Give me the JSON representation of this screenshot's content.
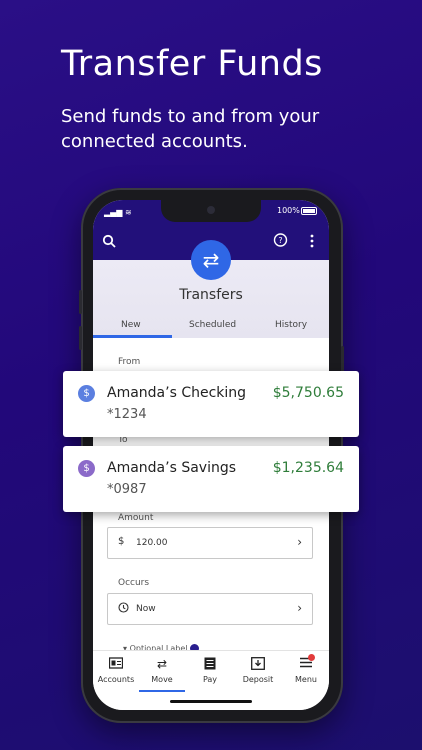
{
  "promo": {
    "headline": "Transfer Funds",
    "subline": "Send funds to and from your connected accounts."
  },
  "status_bar": {
    "signal": "▂▄▆ ≋",
    "battery": "100%"
  },
  "header": {
    "title": "Transfers",
    "icons": [
      "search-icon",
      "help-icon",
      "more-vertical-icon",
      "transfer-arrows-icon"
    ]
  },
  "tabs": [
    {
      "label": "New",
      "active": true
    },
    {
      "label": "Scheduled",
      "active": false
    },
    {
      "label": "History",
      "active": false
    }
  ],
  "form": {
    "from_label": "From",
    "to_label": "To",
    "amount_label": "Amount",
    "amount_currency": "$",
    "amount_value": "120.00",
    "occurs_label": "Occurs",
    "occurs_value": "Now",
    "optional_label": "Optional Label"
  },
  "accounts": [
    {
      "name": "Amanda’s Checking",
      "number": "*1234",
      "balance": "$5,750.65",
      "color": "#5b7fe0"
    },
    {
      "name": "Amanda’s Savings",
      "number": "*0987",
      "balance": "$1,235.64",
      "color": "#8b6ac9"
    }
  ],
  "bottom_nav": [
    {
      "label": "Accounts",
      "icon": "accounts-icon",
      "active": false
    },
    {
      "label": "Move",
      "icon": "move-icon",
      "active": true
    },
    {
      "label": "Pay",
      "icon": "pay-icon",
      "active": false
    },
    {
      "label": "Deposit",
      "icon": "deposit-icon",
      "active": false
    },
    {
      "label": "Menu",
      "icon": "menu-icon",
      "active": false
    }
  ],
  "colors": {
    "brand_purple": "#22107a",
    "accent_blue": "#2f67e6",
    "balance_green": "#2f7d3a",
    "notification_red": "#e23b3b"
  }
}
